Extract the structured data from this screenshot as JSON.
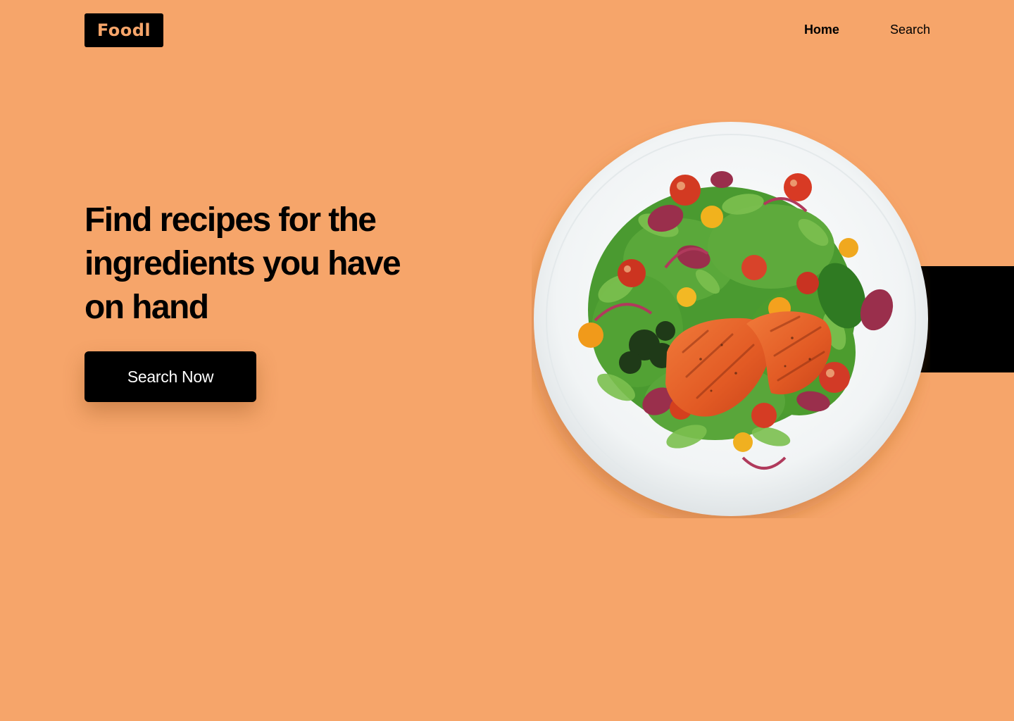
{
  "header": {
    "logo_text": "Foodl",
    "nav": [
      {
        "label": "Home",
        "active": true
      },
      {
        "label": "Search",
        "active": false
      }
    ]
  },
  "hero": {
    "title_lines": [
      "Find recipes for the",
      "ingredients you have",
      "on hand"
    ],
    "cta_label": "Search Now",
    "image_subject": "salad-with-salmon-on-white-plate"
  },
  "colors": {
    "background": "#f6a56a",
    "primary": "#000000",
    "logo_text": "#f6a56a",
    "button_text": "#ffffff"
  }
}
